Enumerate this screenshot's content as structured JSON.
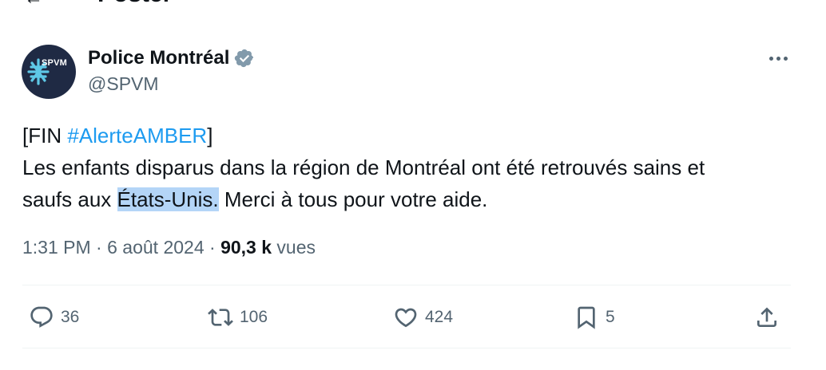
{
  "header": {
    "title": "Poster",
    "back_icon": "arrow-left-icon"
  },
  "author": {
    "display_name": "Police Montréal",
    "handle": "@SPVM",
    "avatar_text": "SPVM",
    "verified_icon": "verified-badge-icon",
    "verified_color": "#829aab"
  },
  "more_icon": "more-horizontal-icon",
  "tweet": {
    "line1_bracket_open": "[FIN ",
    "hashtag": "#AlerteAMBER",
    "line1_bracket_close": "]",
    "line2": "Les enfants disparus dans la région de Montréal ont été retrouvés sains et",
    "line3_prefix": "saufs aux ",
    "line3_highlight": "États-Unis.",
    "line3_suffix": " Merci à tous pour votre aide."
  },
  "meta": {
    "time": "1:31 PM",
    "sep1": " · ",
    "date": "6 août 2024",
    "sep2": " · ",
    "views_count": "90,3 k",
    "views_label": " vues"
  },
  "actions": {
    "replies": "36",
    "reposts": "106",
    "likes": "424",
    "bookmarks": "5"
  },
  "colors": {
    "link": "#1d9bf0",
    "secondary_text": "#536471",
    "highlight": "#b4d5f7"
  }
}
